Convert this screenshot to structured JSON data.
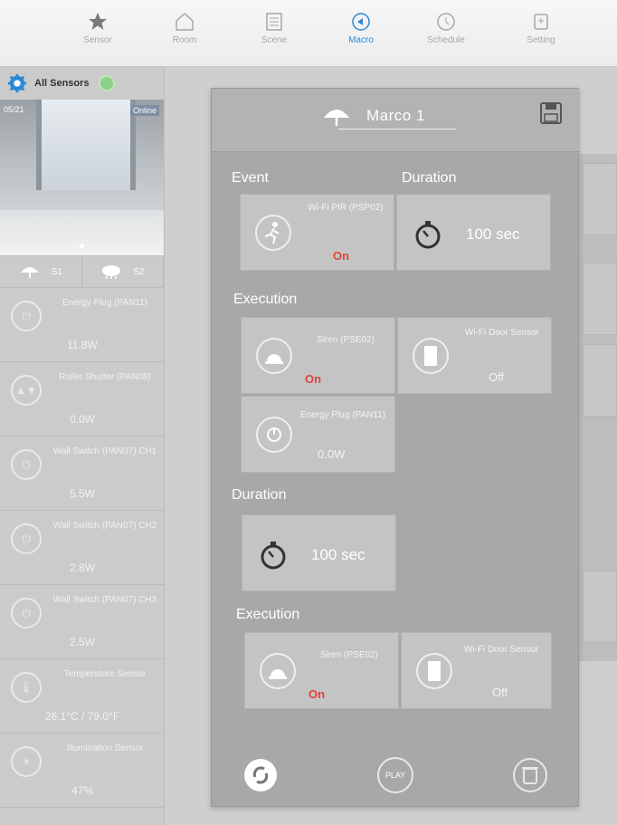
{
  "tabs": [
    {
      "label": "Sensor",
      "icon": "star-icon"
    },
    {
      "label": "Room",
      "icon": "house-icon"
    },
    {
      "label": "Scene",
      "icon": "scene-icon"
    },
    {
      "label": "Macro",
      "icon": "macro-icon",
      "active": true
    },
    {
      "label": "Schedule",
      "icon": "clock-icon"
    },
    {
      "label": "Setting",
      "icon": "setting-icon"
    }
  ],
  "sidebar": {
    "title": "All Sensors",
    "camera": {
      "time": "05/21",
      "status": "Online"
    },
    "switches": [
      {
        "label": "S1",
        "icon": "umbrella-icon"
      },
      {
        "label": "S2",
        "icon": "cloud-rain-icon"
      }
    ],
    "devices": [
      {
        "name": "Energy Plug (PAN11)",
        "value": "11.8W",
        "icon": "plug-icon",
        "glyph": "⏻"
      },
      {
        "name": "Roller Shutter (PAN08)",
        "value": "0.0W",
        "icon": "shutter-icon",
        "glyph": "▲▼"
      },
      {
        "name": "Wall Switch (PAN07) CH1",
        "value": "5.5W",
        "icon": "switch-icon",
        "glyph": "⏻"
      },
      {
        "name": "Wall Switch (PAN07) CH2",
        "value": "2.8W",
        "icon": "switch-icon",
        "glyph": "⏻"
      },
      {
        "name": "Wall Switch (PAN07) CH3",
        "value": "2.5W",
        "icon": "switch-icon",
        "glyph": "⏻"
      },
      {
        "name": "Temperature Sensor",
        "value": "26.1°C / 79.0°F",
        "icon": "thermometer-icon",
        "glyph": "🌡"
      },
      {
        "name": "Illumination Sensor",
        "value": "47%",
        "icon": "bulb-icon",
        "glyph": "☀"
      }
    ]
  },
  "macro": {
    "title": "Marco 1",
    "event_label": "Event",
    "duration_label": "Duration",
    "execution_label": "Execution",
    "event": {
      "name": "Wi-Fi PIR (PSP02)",
      "state": "On"
    },
    "duration_1": "100 sec",
    "execution_1": [
      {
        "name": "Siren (PSE02)",
        "state": "On",
        "icon": "siren-icon"
      },
      {
        "name": "Wi-Fi Door Sensor",
        "state": "Off",
        "icon": "door-icon"
      },
      {
        "name": "Energy Plug (PAN11)",
        "state": "0.0W",
        "icon": "plug-icon"
      }
    ],
    "duration_2": "100 sec",
    "execution_2": [
      {
        "name": "Siren (PSE02)",
        "state": "On",
        "icon": "siren-icon"
      },
      {
        "name": "Wi-Fi Door Sensor",
        "state": "Off",
        "icon": "door-icon"
      }
    ],
    "play_label": "PLAY"
  }
}
